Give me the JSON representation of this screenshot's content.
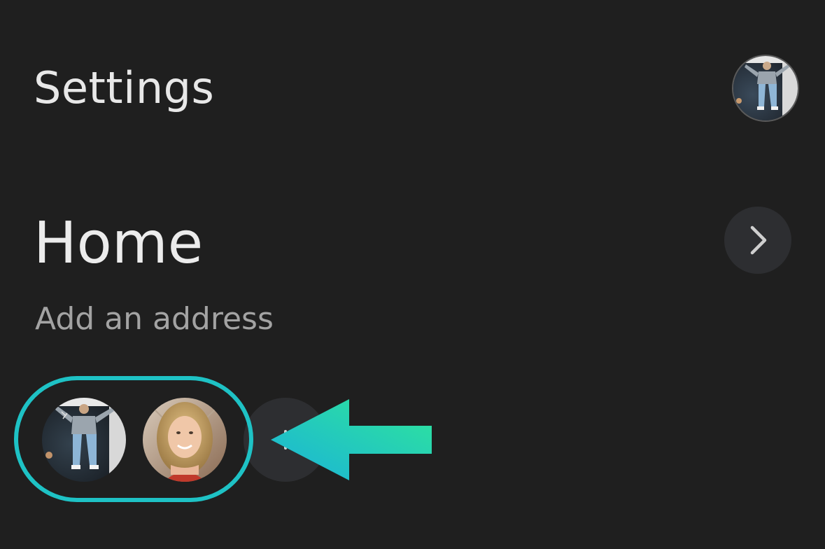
{
  "header": {
    "title": "Settings",
    "profile_avatar_icon": "user-avatar-photo"
  },
  "home": {
    "title": "Home",
    "subtitle": "Add an address",
    "open_icon": "chevron-right-icon"
  },
  "members": {
    "items": [
      {
        "icon": "member-avatar-man-jumping"
      },
      {
        "icon": "member-avatar-woman-smiling"
      }
    ],
    "add_icon": "plus-icon"
  },
  "annotation": {
    "outline_color": "#1ec2c5",
    "arrow_gradient": [
      "#2fe69a",
      "#1ab2d9"
    ]
  },
  "colors": {
    "background": "#1f1f1f",
    "button_bg": "#2d2e31",
    "text_primary": "#ececec",
    "text_secondary": "#a3a3a3"
  }
}
